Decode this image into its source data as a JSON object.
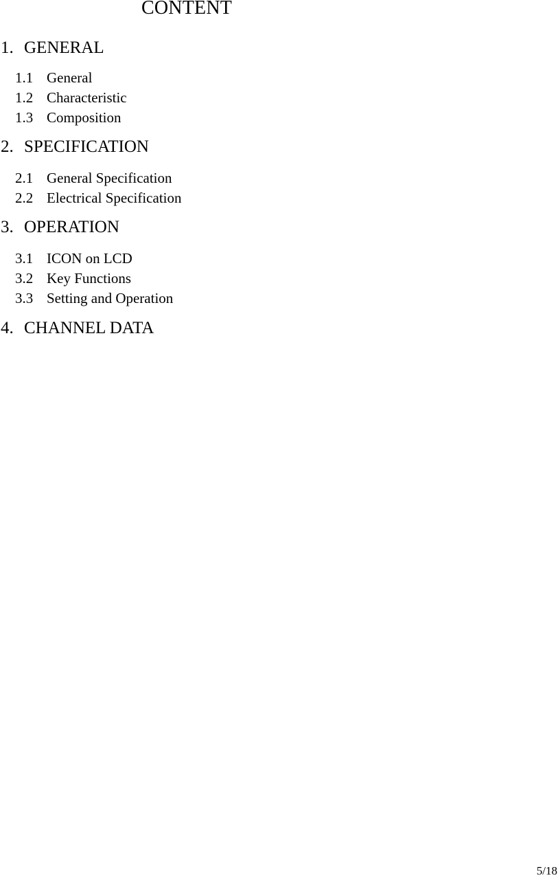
{
  "document": {
    "title": "CONTENT",
    "page_number": "5/18",
    "sections": [
      {
        "number": "1.",
        "label": "GENERAL",
        "subsections": [
          {
            "number": "1.1",
            "label": "General"
          },
          {
            "number": "1.2",
            "label": "Characteristic"
          },
          {
            "number": "1.3",
            "label": "Composition"
          }
        ]
      },
      {
        "number": "2.",
        "label": "SPECIFICATION",
        "subsections": [
          {
            "number": "2.1",
            "label": "General Specification"
          },
          {
            "number": "2.2",
            "label": "Electrical Specification"
          }
        ]
      },
      {
        "number": "3.",
        "label": "OPERATION",
        "subsections": [
          {
            "number": "3.1",
            "label": "ICON on LCD"
          },
          {
            "number": "3.2",
            "label": "Key Functions"
          },
          {
            "number": "3.3",
            "label": "Setting and Operation"
          }
        ]
      },
      {
        "number": "4.",
        "label": "CHANNEL DATA",
        "subsections": []
      }
    ]
  }
}
